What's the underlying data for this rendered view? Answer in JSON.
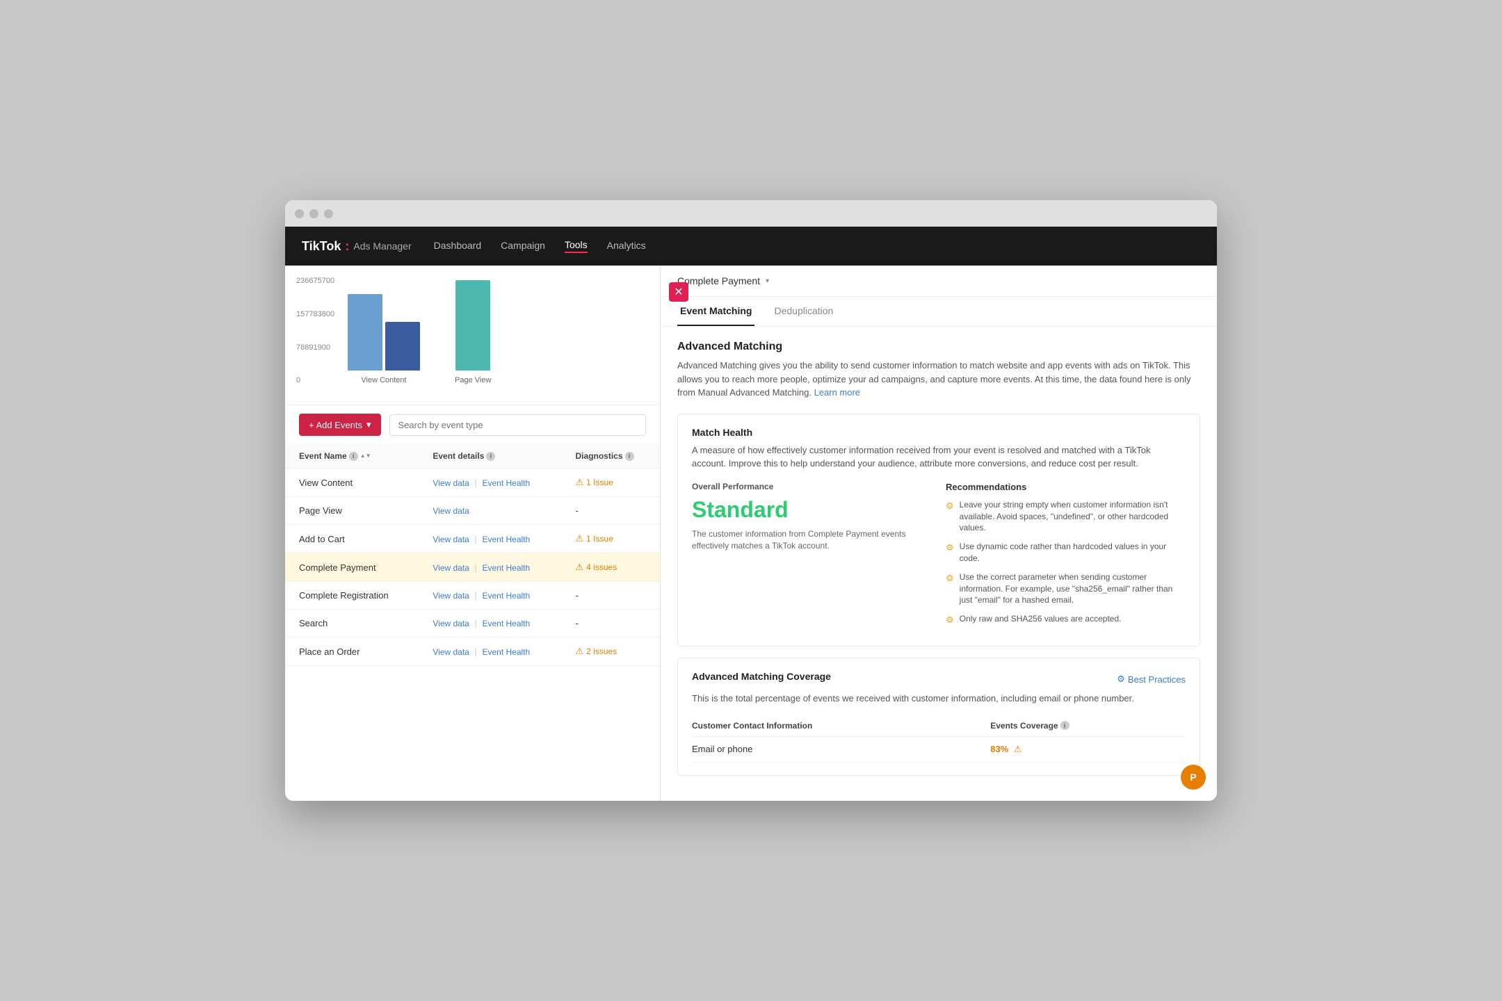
{
  "window": {
    "title": "TikTok Ads Manager"
  },
  "nav": {
    "brand": "TikTok",
    "colon": ":",
    "sub": "Ads Manager",
    "items": [
      {
        "label": "Dashboard",
        "active": false
      },
      {
        "label": "Campaign",
        "active": false
      },
      {
        "label": "Tools",
        "active": true
      },
      {
        "label": "Analytics",
        "active": false
      }
    ]
  },
  "chart": {
    "y_labels": [
      "236675700",
      "157783800",
      "78891900",
      "0"
    ],
    "bars": [
      {
        "label": "View Content"
      },
      {
        "label": "Page View"
      }
    ]
  },
  "table_controls": {
    "add_events_label": "+ Add Events",
    "search_placeholder": "Search by event type"
  },
  "table": {
    "headers": [
      "Event Name",
      "Event details",
      "Diagnostics"
    ],
    "rows": [
      {
        "name": "View Content",
        "has_view_data": true,
        "has_event_health": true,
        "diagnostics": "1 Issue",
        "has_issue": true,
        "highlighted": false,
        "selected": false
      },
      {
        "name": "Page View",
        "has_view_data": true,
        "has_event_health": false,
        "diagnostics": "-",
        "has_issue": false,
        "highlighted": false,
        "selected": false
      },
      {
        "name": "Add to Cart",
        "has_view_data": true,
        "has_event_health": true,
        "diagnostics": "1 Issue",
        "has_issue": true,
        "highlighted": false,
        "selected": false
      },
      {
        "name": "Complete Payment",
        "has_view_data": true,
        "has_event_health": true,
        "diagnostics": "4 issues",
        "has_issue": true,
        "highlighted": true,
        "selected": false
      },
      {
        "name": "Complete Registration",
        "has_view_data": true,
        "has_event_health": true,
        "diagnostics": "-",
        "has_issue": false,
        "highlighted": false,
        "selected": false
      },
      {
        "name": "Search",
        "has_view_data": true,
        "has_event_health": true,
        "diagnostics": "-",
        "has_issue": false,
        "highlighted": false,
        "selected": false
      },
      {
        "name": "Place an Order",
        "has_view_data": true,
        "has_event_health": true,
        "diagnostics": "2 issues",
        "has_issue": true,
        "highlighted": false,
        "selected": false
      }
    ]
  },
  "right_panel": {
    "header": {
      "event_name": "Complete Payment",
      "dropdown_label": "Complete Payment ▾"
    },
    "tabs": [
      {
        "label": "Event Matching",
        "active": true
      },
      {
        "label": "Deduplication",
        "active": false
      }
    ],
    "advanced_matching": {
      "title": "Advanced Matching",
      "description": "Advanced Matching gives you the ability to send customer information to match website and app events with ads on TikTok. This allows you to reach more people, optimize your ad campaigns, and capture more events. At this time, the data found here is only from Manual Advanced Matching.",
      "learn_more": "Learn more"
    },
    "match_health": {
      "title": "Match Health",
      "description": "A measure of how effectively customer information received from your event is resolved and matched with a TikTok account. Improve this to help understand your audience, attribute more conversions, and reduce cost per result.",
      "overall_performance": {
        "label": "Overall Performance",
        "rating": "Standard",
        "subdesc": "The customer information from Complete Payment events effectively matches a TikTok account."
      },
      "recommendations": {
        "label": "Recommendations",
        "items": [
          "Leave your string empty when customer information isn't available. Avoid spaces, \"undefined\", or other hardcoded values.",
          "Use dynamic code rather than hardcoded values in your code.",
          "Use the correct parameter when sending customer information. For example, use \"sha256_email\" rather than just \"email\" for a hashed email.",
          "Only raw and SHA256 values are accepted."
        ]
      }
    },
    "advanced_matching_coverage": {
      "title": "Advanced Matching Coverage",
      "best_practices_label": "Best Practices",
      "description": "This is the total percentage of events we received with customer information, including email or phone number.",
      "table": {
        "headers": [
          "Customer Contact Information",
          "Events Coverage"
        ],
        "rows": [
          {
            "label": "Email or phone",
            "value": "83%",
            "has_warn": true
          }
        ]
      }
    }
  },
  "avatar": {
    "initial": "P"
  }
}
